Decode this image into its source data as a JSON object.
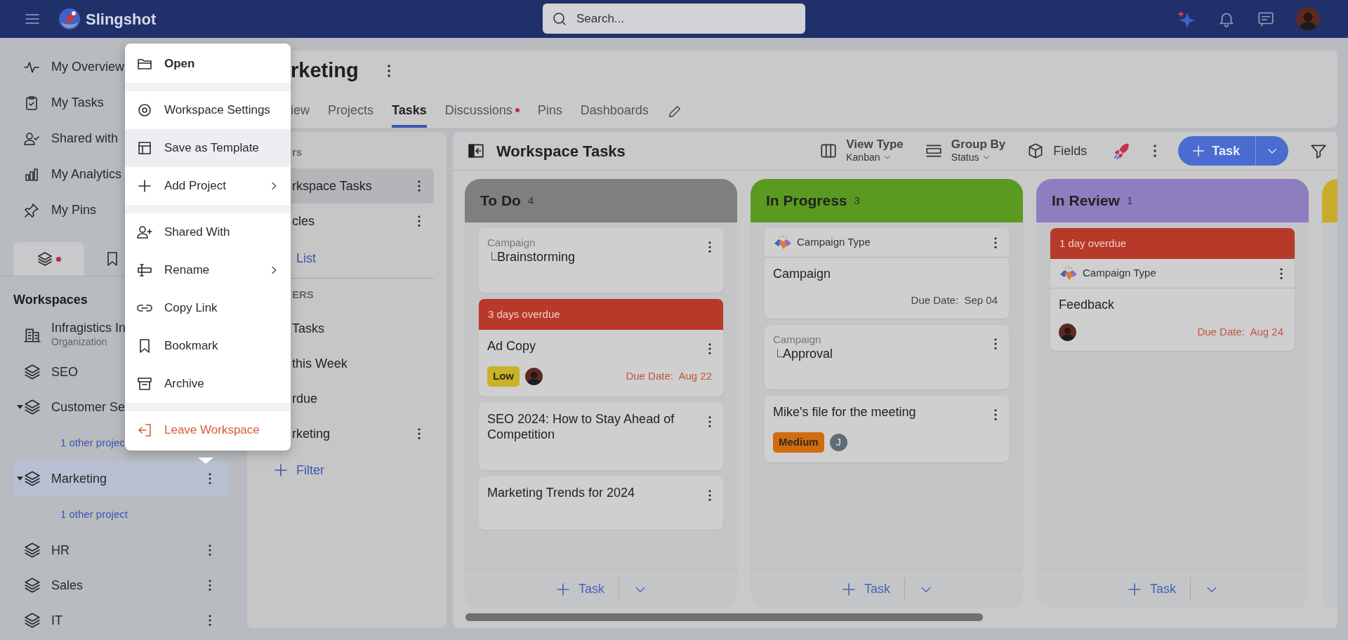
{
  "top_bar": {
    "app_name": "Slingshot",
    "search": {
      "placeholder": "Search..."
    }
  },
  "sidebar": {
    "nav": [
      {
        "label": "My Overview"
      },
      {
        "label": "My Tasks"
      },
      {
        "label": "Shared with"
      },
      {
        "label": "My Analytics"
      },
      {
        "label": "My Pins"
      }
    ],
    "tabs": [
      {
        "selected": true,
        "badge": true
      },
      {
        "selected": false
      }
    ],
    "heading": "Workspaces",
    "workspaces": [
      {
        "kind": "org",
        "name": "Infragistics In",
        "subtitle": "Organization",
        "selected": false,
        "expanded": false
      },
      {
        "kind": "workspace",
        "name": "SEO",
        "selected": false,
        "expanded": false
      },
      {
        "kind": "workspace",
        "name": "Customer Se",
        "selected": false,
        "expanded": true,
        "children": [
          {
            "label": "1 other projec"
          }
        ]
      },
      {
        "kind": "workspace",
        "name": "Marketing",
        "selected": true,
        "expanded": true,
        "has_menu": true,
        "children": [
          {
            "label": "1 other project"
          }
        ]
      },
      {
        "kind": "workspace",
        "name": "HR",
        "selected": false,
        "expanded": false,
        "has_menu": true
      },
      {
        "kind": "workspace",
        "name": "Sales",
        "selected": false,
        "expanded": false,
        "has_menu": true
      },
      {
        "kind": "workspace",
        "name": "IT",
        "selected": false,
        "expanded": false,
        "has_menu": true
      }
    ]
  },
  "context_menu": {
    "items": [
      {
        "kind": "item",
        "label": "Open",
        "bold": true,
        "highlighted": false,
        "submenu": false,
        "danger": false
      },
      {
        "kind": "separator"
      },
      {
        "kind": "item",
        "label": "Workspace Settings",
        "bold": false,
        "highlighted": false,
        "submenu": false,
        "danger": false
      },
      {
        "kind": "item",
        "label": "Save as Template",
        "bold": false,
        "highlighted": true,
        "submenu": false,
        "danger": false
      },
      {
        "kind": "item",
        "label": "Add Project",
        "bold": false,
        "highlighted": false,
        "submenu": true,
        "danger": false
      },
      {
        "kind": "separator"
      },
      {
        "kind": "item",
        "label": "Shared With",
        "bold": false,
        "highlighted": false,
        "submenu": false,
        "danger": false
      },
      {
        "kind": "item",
        "label": "Rename",
        "bold": false,
        "highlighted": false,
        "submenu": true,
        "danger": false
      },
      {
        "kind": "item",
        "label": "Copy Link",
        "bold": false,
        "highlighted": false,
        "submenu": false,
        "danger": false
      },
      {
        "kind": "item",
        "label": "Bookmark",
        "bold": false,
        "highlighted": false,
        "submenu": false,
        "danger": false
      },
      {
        "kind": "item",
        "label": "Archive",
        "bold": false,
        "highlighted": false,
        "submenu": false,
        "danger": false
      },
      {
        "kind": "separator"
      },
      {
        "kind": "item",
        "label": "Leave Workspace",
        "bold": false,
        "highlighted": false,
        "submenu": false,
        "danger": true
      }
    ]
  },
  "workspace_header": {
    "title": "rketing",
    "tabs": [
      {
        "label": "iew",
        "selected": false,
        "dot": false
      },
      {
        "label": "Projects",
        "selected": false,
        "dot": false
      },
      {
        "label": "Tasks",
        "selected": true,
        "dot": false
      },
      {
        "label": "Discussions",
        "selected": false,
        "dot": true
      },
      {
        "label": "Pins",
        "selected": false,
        "dot": false
      },
      {
        "label": "Dashboards",
        "selected": false,
        "dot": false
      }
    ]
  },
  "views_panel": {
    "items": [
      {
        "kind": "header",
        "label": "rs"
      },
      {
        "kind": "view",
        "label": "rkspace Tasks",
        "selected": true,
        "has_menu": true
      },
      {
        "kind": "view",
        "label": "cles",
        "selected": false,
        "has_menu": true
      },
      {
        "kind": "link",
        "label": "List"
      },
      {
        "kind": "divider"
      },
      {
        "kind": "header",
        "label": "ERS"
      },
      {
        "kind": "view",
        "label": "Tasks",
        "selected": false,
        "has_menu": false
      },
      {
        "kind": "view",
        "label": "this Week",
        "selected": false,
        "has_menu": false
      },
      {
        "kind": "view",
        "label": "rdue",
        "selected": false,
        "has_menu": false
      },
      {
        "kind": "view",
        "label": "rketing",
        "selected": false,
        "has_menu": true
      },
      {
        "kind": "add",
        "label": "Filter"
      }
    ]
  },
  "board": {
    "title": "Workspace Tasks",
    "toolbar": {
      "view_type": {
        "label": "View Type",
        "value": "Kanban"
      },
      "group_by": {
        "label": "Group By",
        "value": "Status"
      },
      "fields": "Fields",
      "new_task": "Task"
    },
    "columns": [
      {
        "title": "To Do",
        "count": "4",
        "color": "#7f7f7f",
        "add_label": "Task",
        "cards": [
          {
            "parent": "Campaign",
            "title": "Brainstorming"
          },
          {
            "overdue": "3 days overdue",
            "title": "Ad Copy",
            "priority": {
              "label": "Low",
              "color": "#c9b225"
            },
            "assignees": [
              {
                "kind": "photo"
              }
            ],
            "due": "Due Date:  Aug 22",
            "due_late": true
          },
          {
            "title": "SEO 2024: How to Stay Ahead of Competition"
          },
          {
            "title": "Marketing Trends for 2024"
          }
        ]
      },
      {
        "title": "In Progress",
        "count": "3",
        "color": "#5a9a20",
        "add_label": "Task",
        "cards": [
          {
            "type_label": "Campaign Type",
            "title": "Campaign",
            "due": "Due Date:  Sep 04",
            "due_late": false
          },
          {
            "parent": "Campaign",
            "title": "Approval"
          },
          {
            "title": "Mike's file for the meeting",
            "priority": {
              "label": "Medium",
              "color": "#d06c0c"
            },
            "assignees": [
              {
                "kind": "initial",
                "initial": "J"
              }
            ]
          }
        ]
      },
      {
        "title": "In Review",
        "count": "1",
        "color": "#8d7fbf",
        "add_label": "Task",
        "cards": [
          {
            "overdue": "1 day overdue",
            "type_label": "Campaign Type",
            "title": "Feedback",
            "assignees": [
              {
                "kind": "photo"
              }
            ],
            "due": "Due Date:  Aug 24",
            "due_late": true
          }
        ]
      },
      {
        "color": "#c9ab2c"
      }
    ]
  }
}
